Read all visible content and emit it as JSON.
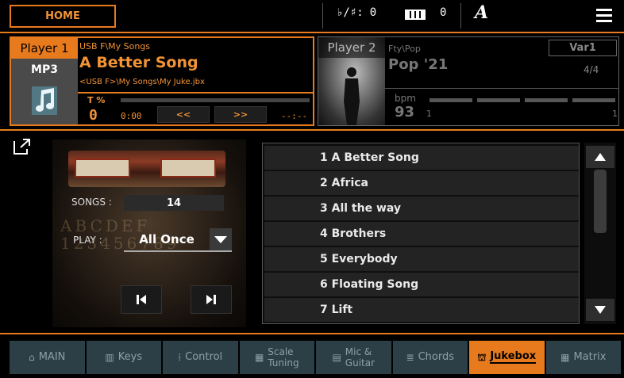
{
  "topbar": {
    "home_label": "HOME",
    "transpose_symbol": "♭/♯:",
    "transpose_value": "0",
    "octave_value": "0",
    "tuning_label": "A"
  },
  "player1": {
    "tab_label": "Player 1",
    "type_label": "MP3",
    "path": "USB F\\My Songs",
    "title": "A Better Song",
    "file": "<USB F>\\My Songs\\My Juke.jbx",
    "tempo_label": "T %",
    "tempo_value": "0",
    "time": "0:00",
    "rewind_label": "<<",
    "forward_label": ">>",
    "remaining": "--:--",
    "progress": 0
  },
  "player2": {
    "tab_label": "Player 2",
    "path": "Fty\\Pop",
    "title": "Pop '21",
    "variation": "Var1",
    "meter": "4/4",
    "bpm_label": "bpm",
    "bpm_value": "93",
    "beat_start": "1",
    "beat_end": "1"
  },
  "jukebox": {
    "songs_label": "SONGS :",
    "songs_count": "14",
    "play_label": "PLAY :",
    "play_mode": "All Once"
  },
  "songlist": {
    "items": [
      "1 A Better Song",
      "2 Africa",
      "3 All the way",
      "4 Brothers",
      "5 Everybody",
      "6 Floating Song",
      "7 Lift"
    ]
  },
  "tabs": [
    {
      "icon": "home-icon",
      "lines": [
        "MAIN"
      ]
    },
    {
      "icon": "keys-icon",
      "lines": [
        "Keys"
      ]
    },
    {
      "icon": "control-icon",
      "lines": [
        "Control"
      ]
    },
    {
      "icon": "scale-icon",
      "lines": [
        "Scale",
        "Tuning"
      ]
    },
    {
      "icon": "mic-icon",
      "lines": [
        "Mic &",
        "Guitar"
      ]
    },
    {
      "icon": "chords-icon",
      "lines": [
        "Chords"
      ]
    },
    {
      "icon": "jukebox-icon",
      "lines": [
        "Jukebox"
      ]
    },
    {
      "icon": "matrix-icon",
      "lines": [
        "Matrix"
      ]
    }
  ],
  "colors": {
    "accent": "#e87a1e",
    "tab_bg": "#2c3f47",
    "list_row": "#232323"
  }
}
